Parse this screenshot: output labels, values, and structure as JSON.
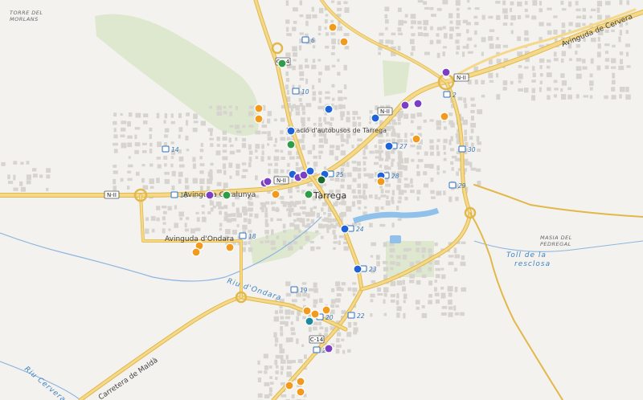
{
  "map": {
    "city_label": "Tàrrega",
    "place_labels": [
      {
        "id": "torre-del-morlans",
        "lines": [
          "TORRE DEL",
          "MORLANS"
        ]
      },
      {
        "id": "masia-del-pedregal",
        "lines": [
          "MASIA DEL",
          "PEDREGAL"
        ]
      }
    ],
    "street_labels": [
      {
        "id": "avinguda-de-cervera",
        "text": "Avinguda de Cervera"
      },
      {
        "id": "avinguda-catalunya",
        "text": "Avinguda Catalunya"
      },
      {
        "id": "avinguda-dondara",
        "text": "Avinguda d'Ondara"
      },
      {
        "id": "estacio-autobusos",
        "text": "Estació d'autobusos de Tàrrega"
      },
      {
        "id": "carretera-de-maldà",
        "text": "Carretera de Maldà"
      }
    ],
    "water_labels": [
      {
        "id": "toll-de-la-resclosa",
        "lines": [
          "Toll de la",
          "resclosa"
        ]
      },
      {
        "id": "riu-dondara",
        "text": "Riu d'Ondara"
      },
      {
        "id": "riu-cervera",
        "text": "Riu Cervera"
      }
    ],
    "road_shields": [
      "N-II",
      "N-II",
      "N-II",
      "N-II",
      "C-14",
      "C-14"
    ],
    "bus_stop_numbers": [
      "2",
      "6",
      "10",
      "14",
      "16",
      "18",
      "19",
      "20",
      "21",
      "22",
      "23",
      "24",
      "25",
      "27",
      "28",
      "29",
      "30"
    ],
    "colors": {
      "background": "#f4f2ee",
      "park": "#dde8cf",
      "highway": "#f4d98a",
      "highway_casing": "#e2b84a",
      "river": "#8cb6e0",
      "water_lake": "#8fc1ea",
      "building": "#d7d4cf",
      "marker_orange": "#f29a1e",
      "marker_blue": "#1f63d8",
      "marker_purple": "#7b3fc4",
      "marker_green": "#2f9c47",
      "marker_darkgreen": "#1d6a2d",
      "marker_teal": "#1a8aa0"
    },
    "marker_categories": [
      "orange",
      "blue",
      "purple",
      "green",
      "darkgreen",
      "teal"
    ]
  }
}
